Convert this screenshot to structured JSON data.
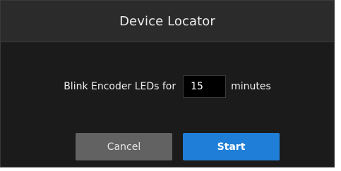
{
  "dialog": {
    "title": "Device Locator"
  },
  "blink": {
    "label": "Blink Encoder LEDs for",
    "minutes_value": "15",
    "unit_label": "minutes"
  },
  "buttons": {
    "cancel_label": "Cancel",
    "start_label": "Start"
  },
  "colors": {
    "dialog_background": "#1b1b1b",
    "header_background": "#2b2b2b",
    "cancel_button": "#626262",
    "start_button": "#1f7fd8"
  }
}
